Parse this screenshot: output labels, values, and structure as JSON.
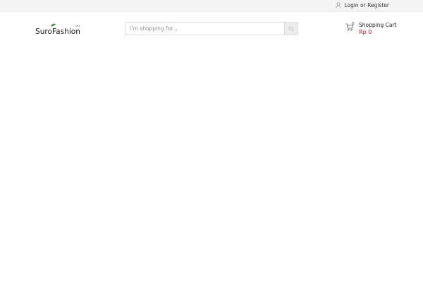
{
  "topbar": {
    "login_text": "Login or Register"
  },
  "header": {
    "logo_text": "SuroFashion",
    "logo_suffix": "net",
    "search": {
      "placeholder": "I’m shopping for..."
    },
    "cart": {
      "count": "0",
      "label": "Shopping Cart",
      "total": "Rp 0"
    }
  },
  "colors": {
    "accent_price": "#c0192b",
    "topbar_bg": "#f4f4f4",
    "logo_leaf": "#2e8b2e"
  }
}
